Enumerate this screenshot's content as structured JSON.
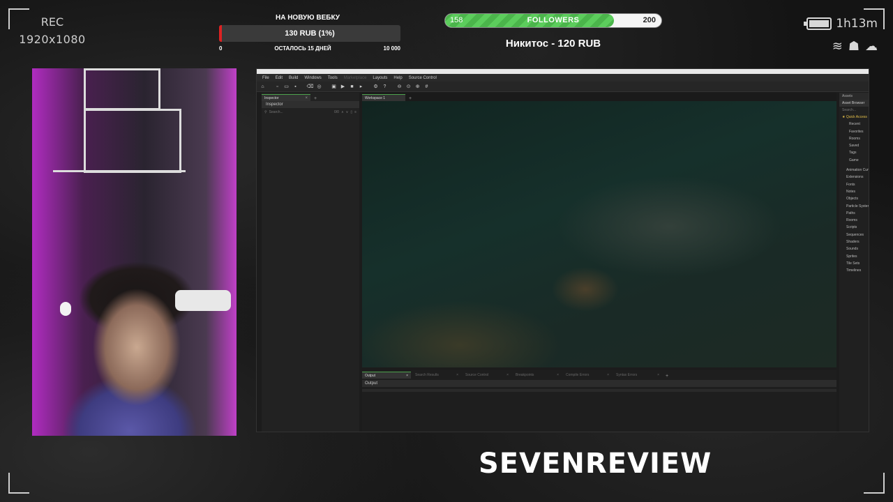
{
  "recorder": {
    "label": "REC",
    "resolution": "1920x1080"
  },
  "goal": {
    "title": "НА НОВУЮ ВЕБКУ",
    "amount": "130 RUB (1%)",
    "progress_fraction": 0.013,
    "start": "0",
    "remaining": "ОСТАЛОСЬ 15 ДНЕЙ",
    "target": "10 000",
    "fill_color": "#dd2222"
  },
  "followers": {
    "start": "158",
    "label": "FOLLOWERS",
    "end": "200",
    "progress_fraction": 0.78,
    "fill_color": "#4bb54b"
  },
  "donor": {
    "text": "Никитос - 120 RUB"
  },
  "status": {
    "duration": "1h13m",
    "battery_icon": "battery-icon",
    "icons": [
      "wind-icon",
      "people-icon",
      "cloud-icon"
    ]
  },
  "gamemaker": {
    "menu": [
      "File",
      "Edit",
      "Build",
      "Windows",
      "Tools",
      "Marketplace",
      "Layouts",
      "Help",
      "Source Control"
    ],
    "toolbar_icons": [
      "home-icon",
      "new-icon",
      "open-icon",
      "save-icon",
      "sep",
      "clean-icon",
      "target-icon",
      "sep",
      "build-icon",
      "play-icon",
      "stop-icon",
      "debug-icon",
      "sep",
      "settings-icon",
      "help-icon",
      "sep",
      "zoom-out-icon",
      "zoom-reset-icon",
      "zoom-in-icon",
      "grid-icon"
    ],
    "inspector": {
      "tab": "Inspector",
      "header": "Inspector",
      "search_placeholder": "Search...",
      "count": "0/0"
    },
    "workspace": {
      "tab": "Workspace 1"
    },
    "assets": {
      "tab": "Assets",
      "header": "Asset Browser",
      "search_placeholder": "Search...",
      "quick": "Quick Access",
      "quick_items": [
        "Recent",
        "Favorites",
        "Rooms",
        "Saved",
        "Tags",
        "Game"
      ],
      "groups": [
        "Animation Curves",
        "Extensions",
        "Fonts",
        "Notes",
        "Objects",
        "Particle Systems",
        "Paths",
        "Rooms",
        "Scripts",
        "Sequences",
        "Shaders",
        "Sounds",
        "Sprites",
        "Tile Sets",
        "Timelines"
      ]
    },
    "output": {
      "tabs": [
        "Output",
        "Search Results",
        "Source Control",
        "Breakpoints",
        "Compile Errors",
        "Syntax Errors"
      ],
      "header": "Output"
    }
  },
  "brand": {
    "text": "SEVENREVIEW"
  }
}
